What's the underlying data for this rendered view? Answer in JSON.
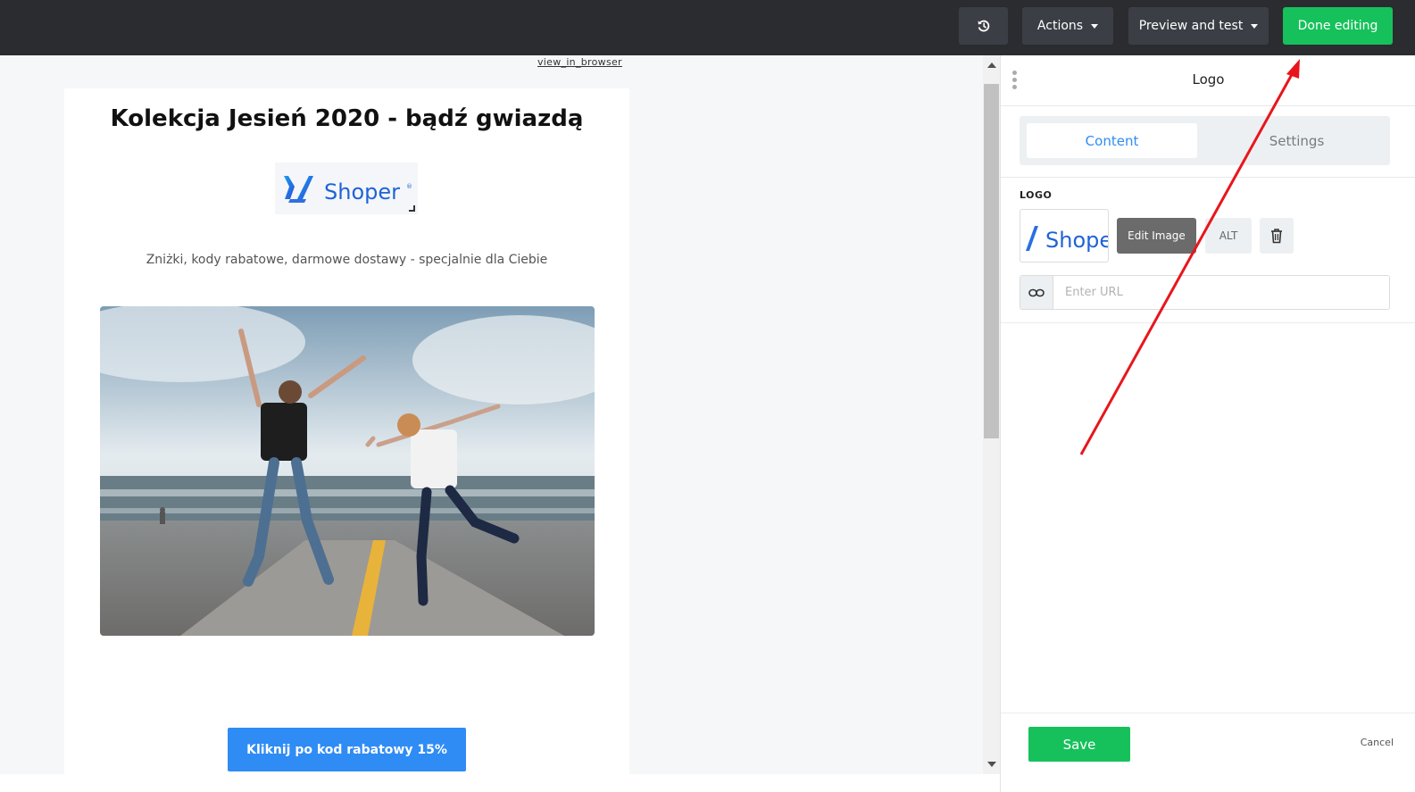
{
  "topbar": {
    "actions_label": "Actions",
    "preview_label": "Preview and test",
    "done_label": "Done editing",
    "done_color": "#16c15b"
  },
  "email": {
    "view_in_browser": "view_in_browser",
    "headline": "Kolekcja Jesień 2020 - bądź gwiazdą",
    "logo_text": "Shoper",
    "logo_mark": "®",
    "subtitle": "Zniżki, kody rabatowe, darmowe dostawy - specjalnie dla Ciebie",
    "cta_label": "Kliknij po kod rabatowy 15%",
    "cta_color": "#2f8cf5"
  },
  "panel": {
    "title": "Logo",
    "tabs": [
      {
        "label": "Content"
      },
      {
        "label": "Settings"
      }
    ],
    "section_label": "LOGO",
    "thumb_text": "Shope",
    "edit_image_label": "Edit Image",
    "alt_label": "ALT",
    "url_placeholder": "Enter URL",
    "save_label": "Save",
    "cancel_label": "Cancel"
  },
  "icons": {
    "history": "history-icon",
    "link": "link-icon",
    "trash": "trash-icon"
  },
  "annotation_color": "#e8161b"
}
